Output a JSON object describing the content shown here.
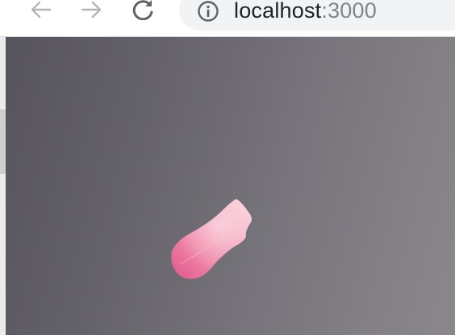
{
  "browser": {
    "url_host": "localhost",
    "url_port": ":3000",
    "icons": {
      "back": "arrow-left-icon",
      "forward": "arrow-right-icon",
      "reload": "reload-icon",
      "info": "info-icon"
    }
  },
  "page": {
    "content": "petal-image",
    "colors": {
      "background_dark": "#56535d",
      "background_light": "#8b888d",
      "petal": "#ef8fae"
    }
  }
}
